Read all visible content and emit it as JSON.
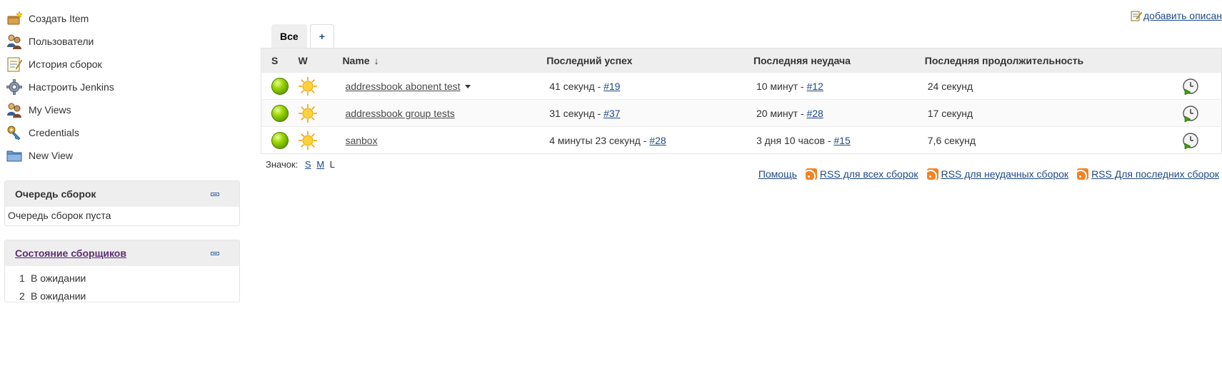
{
  "sidebar": {
    "tasks": [
      {
        "label": "Создать Item",
        "icon": "new-item-icon"
      },
      {
        "label": "Пользователи",
        "icon": "people-icon"
      },
      {
        "label": "История сборок",
        "icon": "notepad-icon"
      },
      {
        "label": "Настроить Jenkins",
        "icon": "gear-icon"
      },
      {
        "label": "My Views",
        "icon": "people-icon"
      },
      {
        "label": "Credentials",
        "icon": "credentials-icon"
      },
      {
        "label": "New View",
        "icon": "folder-icon"
      }
    ]
  },
  "queue": {
    "title": "Очередь сборок",
    "body": "Очередь сборок пуста"
  },
  "executors": {
    "title": "Состояние сборщиков",
    "rows": [
      {
        "num": "1",
        "status": "В ожидании"
      },
      {
        "num": "2",
        "status": "В ожидании"
      }
    ]
  },
  "main": {
    "add_description": "добавить описан",
    "tabs": {
      "active": "Все",
      "add": "+"
    },
    "columns": {
      "s": "S",
      "w": "W",
      "name": "Name",
      "sort_arrow": "↓",
      "last_success": "Последний успех",
      "last_failure": "Последняя неудача",
      "last_duration": "Последняя продолжительность"
    },
    "jobs": [
      {
        "name": "addressbook abonent test",
        "has_menu": true,
        "success_time": "41 секунд - ",
        "success_build": "#19",
        "failure_time": "10 минут - ",
        "failure_build": "#12",
        "duration": "24 секунд"
      },
      {
        "name": "addressbook group tests",
        "has_menu": false,
        "success_time": "31 секунд - ",
        "success_build": "#37",
        "failure_time": "20 минут - ",
        "failure_build": "#28",
        "duration": "17 секунд"
      },
      {
        "name": "sanbox",
        "has_menu": false,
        "success_time": "4 минуты 23 секунд - ",
        "success_build": "#28",
        "failure_time": "3 дня 10 часов - ",
        "failure_build": "#15",
        "duration": "7,6 секунд"
      }
    ],
    "icon_size": {
      "label": "Значок:",
      "s": "S",
      "m": "M",
      "l": "L"
    },
    "footer": {
      "help": "Помощь",
      "rss_all": "RSS для всех сборок",
      "rss_failed": "RSS для неудачных сборок",
      "rss_latest": "RSS Для последних сборок"
    },
    "status_color": "#7fbf00"
  }
}
